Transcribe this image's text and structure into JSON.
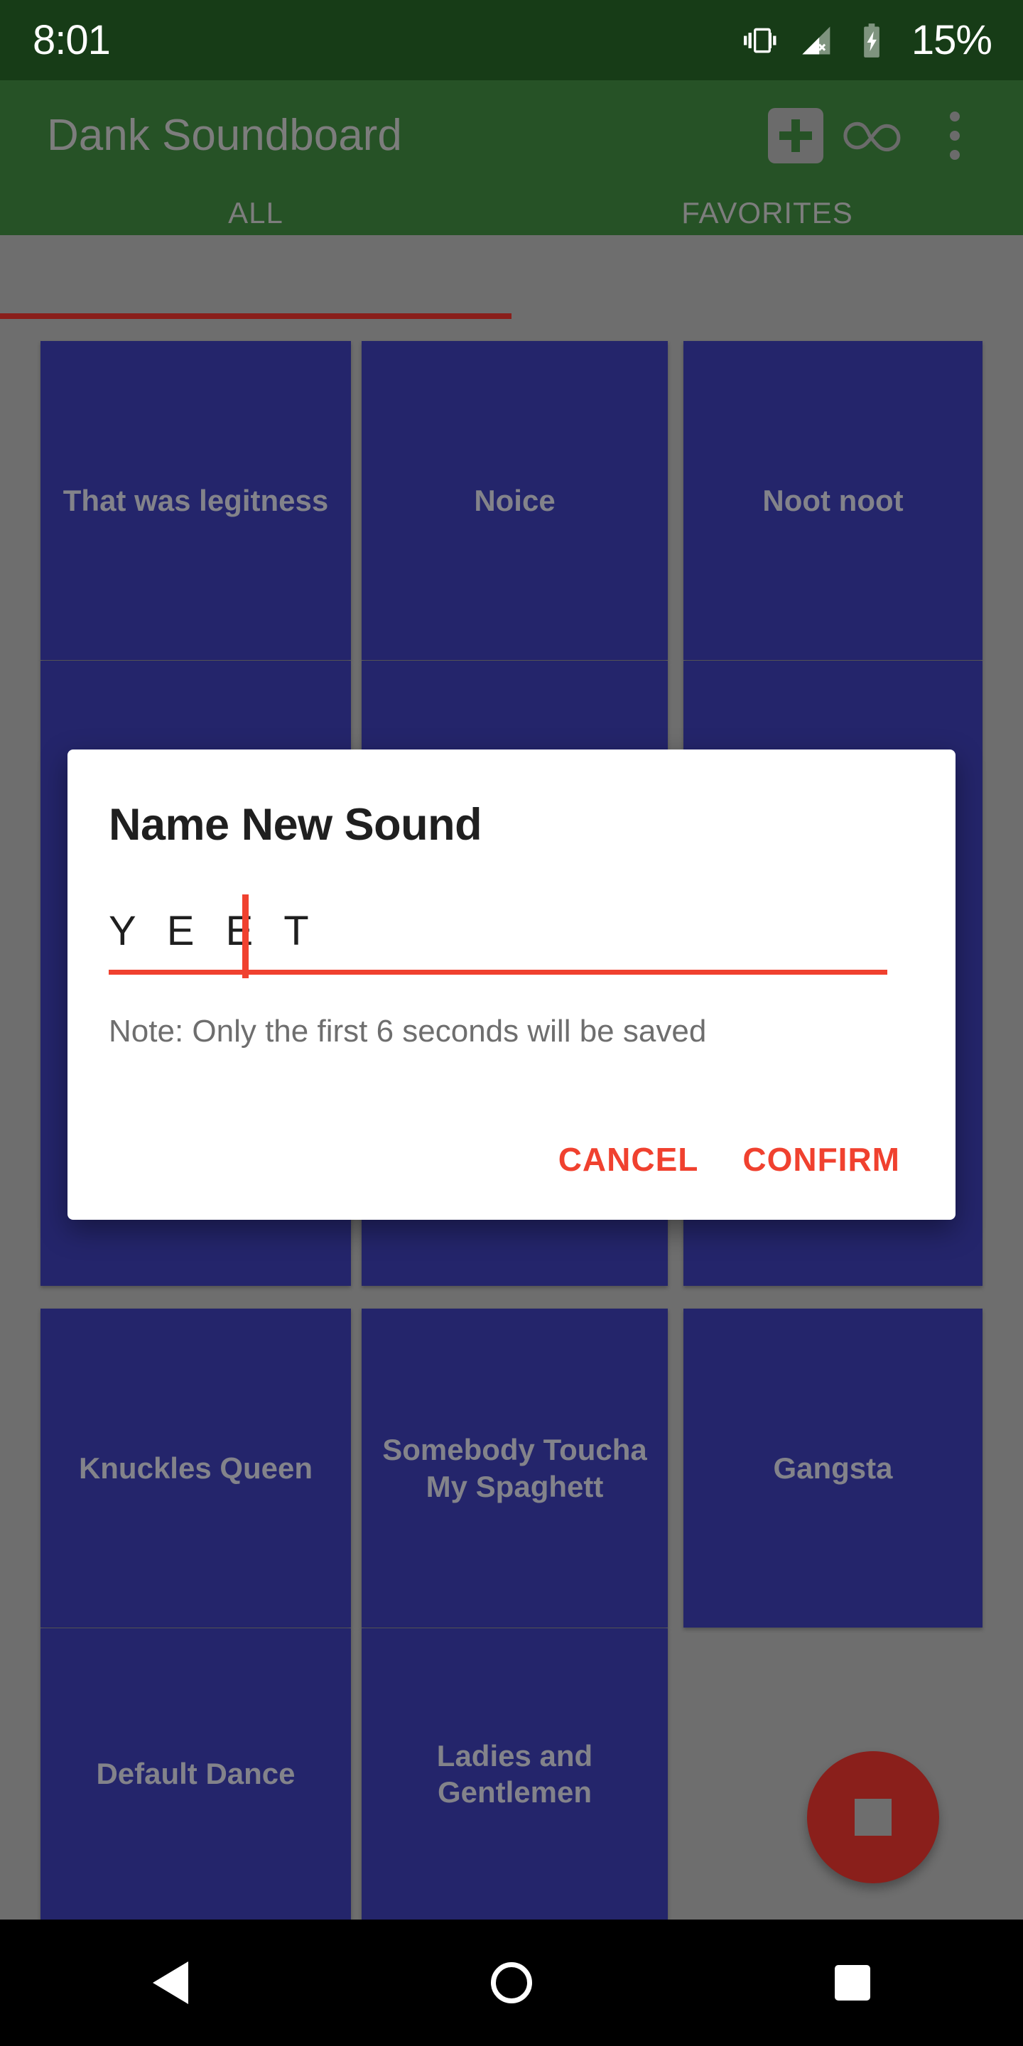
{
  "status_bar": {
    "time": "8:01",
    "battery_percent": "15%",
    "icons": [
      "vibrate-icon",
      "signal-no-sim-icon",
      "battery-charging-icon"
    ]
  },
  "app_bar": {
    "title": "Dank Soundboard",
    "actions": [
      {
        "name": "add-sound-button",
        "icon": "plus-icon"
      },
      {
        "name": "loop-button",
        "icon": "infinity-icon"
      },
      {
        "name": "overflow-menu-button",
        "icon": "more-vertical-icon"
      }
    ]
  },
  "tabs": {
    "items": [
      {
        "label": "ALL",
        "active": true
      },
      {
        "label": "FAVORITES",
        "active": false
      }
    ],
    "indicator_color": "#8a1f1b"
  },
  "sounds": {
    "tile_color": "#24256b",
    "label_color": "#83838a",
    "items": [
      {
        "label": "That was legitness"
      },
      {
        "label": "Noice"
      },
      {
        "label": "Noot noot"
      },
      {
        "label": ""
      },
      {
        "label": ""
      },
      {
        "label": ""
      },
      {
        "label": "Knuckles Queen"
      },
      {
        "label": "Somebody Toucha My Spaghett"
      },
      {
        "label": "Gangsta"
      },
      {
        "label": "Default Dance"
      },
      {
        "label": "Ladies and Gentlemen"
      }
    ]
  },
  "fab": {
    "name": "stop-recording-button",
    "icon": "stop-square-icon",
    "color": "#8a1f1b"
  },
  "dialog": {
    "title": "Name New Sound",
    "input_value": "Y E E T",
    "input_placeholder": "",
    "note": "Note: Only the first 6 seconds will be saved",
    "cancel_label": "CANCEL",
    "confirm_label": "CONFIRM",
    "accent_color": "#f0412f"
  },
  "nav_bar": {
    "back": "back-icon",
    "home": "home-icon",
    "recents": "recents-icon"
  }
}
